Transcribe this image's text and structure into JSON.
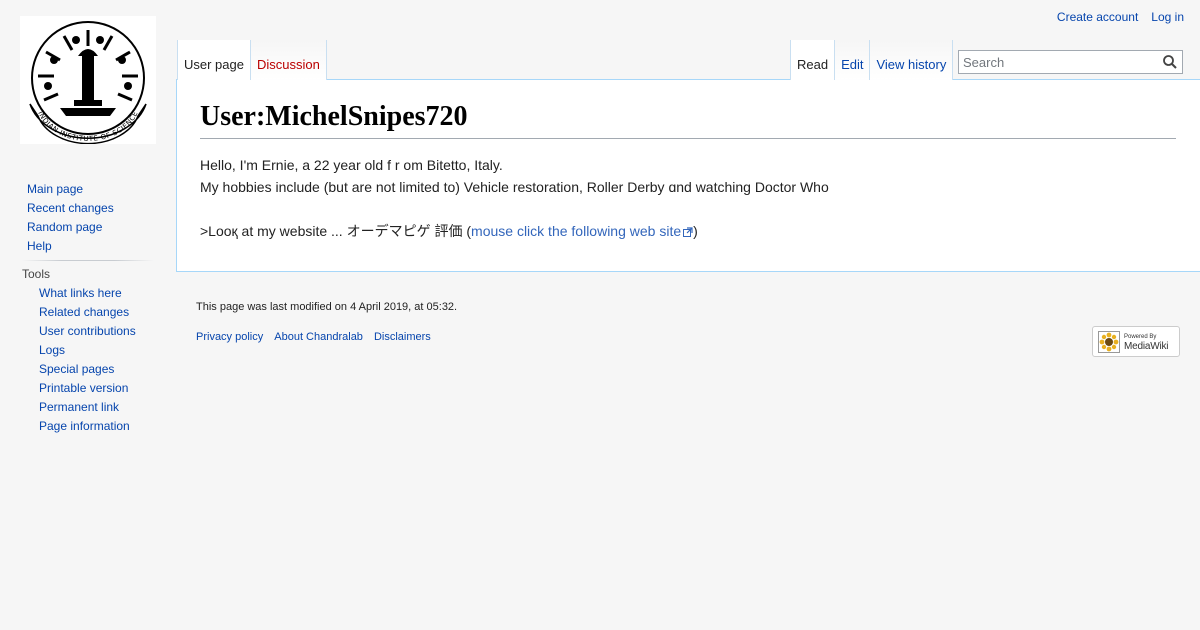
{
  "personal_tools": {
    "create_account": "Create account",
    "log_in": "Log in"
  },
  "logo": {
    "ring_text": "INDIAN INSTITUTE OF SCIENCE"
  },
  "namespaces": [
    {
      "label": "User page",
      "selected": true
    },
    {
      "label": "Discussion",
      "selected": false,
      "new": true
    }
  ],
  "views": [
    {
      "label": "Read",
      "selected": true
    },
    {
      "label": "Edit",
      "selected": false
    },
    {
      "label": "View history",
      "selected": false
    }
  ],
  "search": {
    "placeholder": "Search",
    "value": ""
  },
  "page": {
    "title": "User:MichelSnipes720",
    "line1": "Hello, I'm Ernie, a 22 year old f r om Bitetto, Italy.",
    "line2": "My hobbies include (but are not limited to) Vehicle restoration, Roller Derby ɑnd watching Doctor Wһo",
    "line3_prefix": ">Looқ at my website ... オーデマピゲ 評価 (",
    "line3_link": "mouse click the following web site",
    "line3_suffix": ")"
  },
  "navigation": [
    "Main page",
    "Recent changes",
    "Random page",
    "Help"
  ],
  "tools": {
    "heading": "Tools",
    "items": [
      "What links here",
      "Related changes",
      "User contributions",
      "Logs",
      "Special pages",
      "Printable version",
      "Permanent link",
      "Page information"
    ]
  },
  "footer": {
    "last_modified": "This page was last modified on 4 April 2019, at 05:32.",
    "links": [
      "Privacy policy",
      "About Chandralab",
      "Disclaimers"
    ],
    "powered_small": "Powered By",
    "powered_big": "MediaWiki"
  },
  "colors": {
    "link": "#0645ad",
    "new_link": "#ba0000",
    "external_link": "#3366bb",
    "border": "#a7d7f9"
  }
}
